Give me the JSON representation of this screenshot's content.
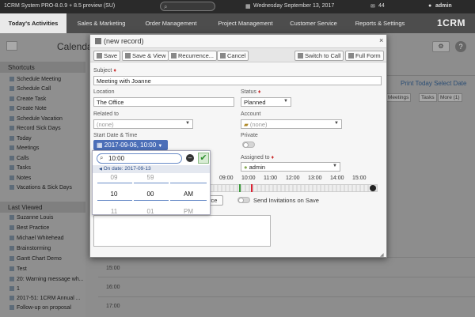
{
  "topbar": {
    "system": "1CRM System PRO-8.0.9 + 8.5 preview (SU)",
    "date": "Wednesday September 13, 2017",
    "count": "44",
    "user": "admin"
  },
  "nav": {
    "items": [
      "Today's Activities",
      "Sales & Marketing",
      "Order Management",
      "Project Management",
      "Customer Service",
      "Reports & Settings"
    ],
    "logo": "1CRM"
  },
  "calendar": {
    "title": "Calendar"
  },
  "left": {
    "shortcuts_title": "Shortcuts",
    "shortcuts": [
      "Schedule Meeting",
      "Schedule Call",
      "Create Task",
      "Create Note",
      "Schedule Vacation",
      "Record Sick Days",
      "Today",
      "Meetings",
      "Calls",
      "Tasks",
      "Notes",
      "Vacations & Sick Days"
    ],
    "last_viewed_title": "Last Viewed",
    "last_viewed": [
      "Suzanne Louis",
      "Best Practice",
      "Michael Whitehead",
      "Brainstorming",
      "Gantt Chart Demo",
      "Test",
      "20: Warning message wh...",
      "1",
      "2017-51: 1CRM Annual ...",
      "Follow-up on proposal"
    ]
  },
  "right": {
    "links": "Print Today Select Date",
    "tabs": [
      "Meetings",
      "Tasks",
      "More (1)"
    ],
    "times": [
      "15:00",
      "16:00",
      "17:00"
    ]
  },
  "modal": {
    "title": "(new record)",
    "close": "×",
    "toolbar": {
      "save": "Save",
      "save_view": "Save & View",
      "recurrence": "Recurrence...",
      "cancel": "Cancel",
      "switch_call": "Switch to Call",
      "full_form": "Full Form"
    },
    "subject_label": "Subject",
    "subject_value": "Meeting with Joanne",
    "location_label": "Location",
    "location_value": "The Office",
    "status_label": "Status",
    "status_value": "Planned",
    "related_label": "Related to",
    "related_value": "(none)",
    "account_label": "Account",
    "account_value": "(none)",
    "start_label": "Start Date & Time",
    "start_value": "2017-09-06, 10:00",
    "private_label": "Private",
    "assigned_label": "Assigned to",
    "assigned_value": "admin",
    "timeline": [
      "09:00",
      "10:00",
      "11:00",
      "12:00",
      "13:00",
      "14:00",
      "15:00"
    ],
    "partial_btn": "rce",
    "send_invites": "Send Invitations on Save"
  },
  "timepicker": {
    "input": "10:00",
    "date": "On date: 2017-09-13",
    "above": [
      "09",
      "59",
      ""
    ],
    "selected": [
      "10",
      "00",
      "AM"
    ],
    "below": [
      "11",
      "01",
      "PM"
    ]
  }
}
